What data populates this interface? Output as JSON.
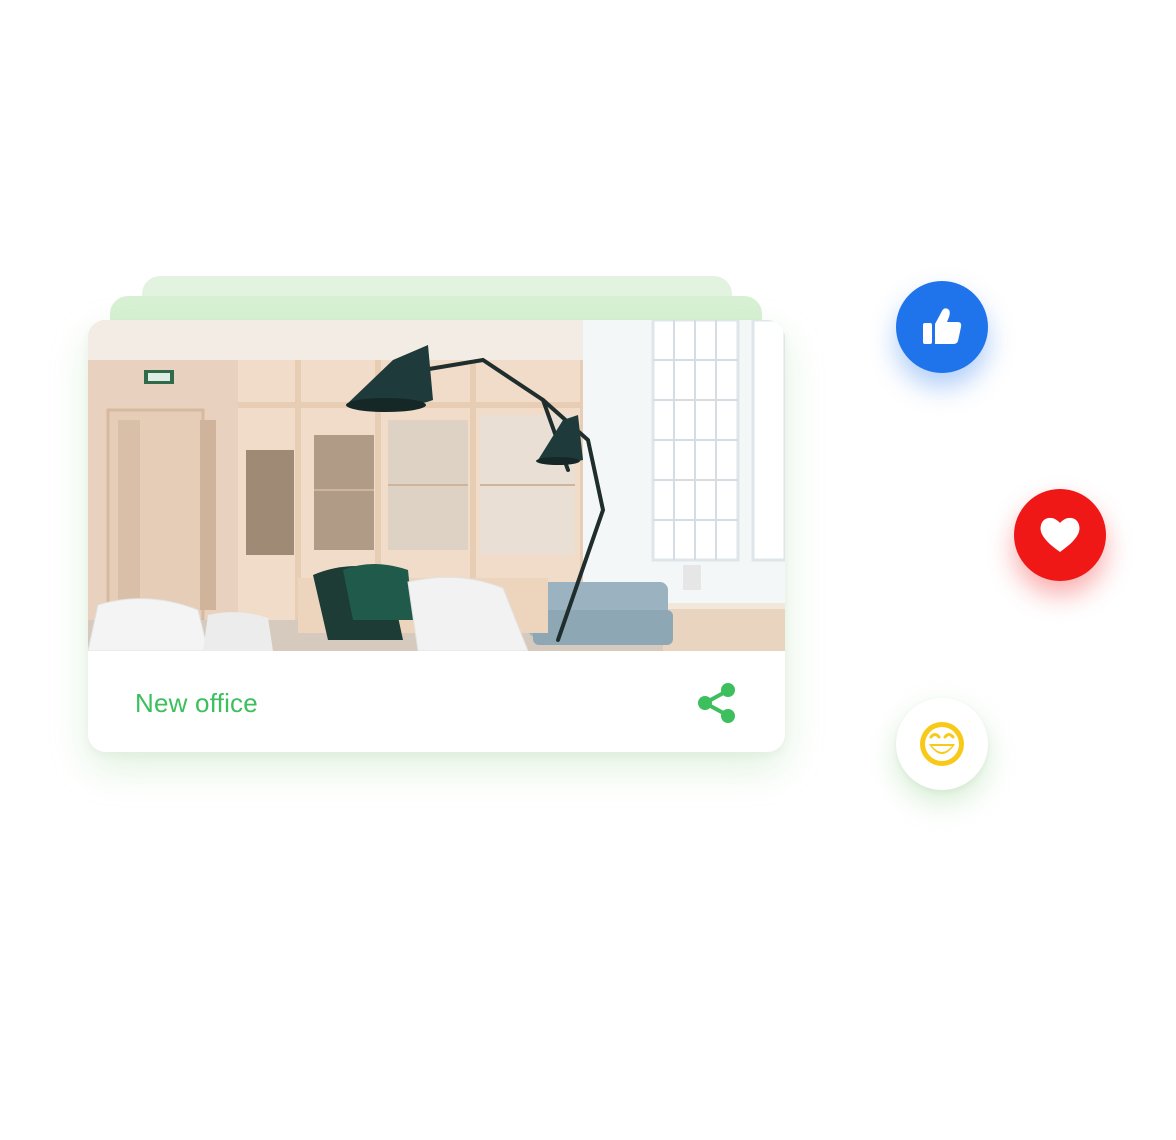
{
  "post_card": {
    "title": "New office",
    "photo_icon": "office-photo",
    "share_icon": "share-icon"
  },
  "reactions": [
    {
      "name": "like",
      "icon": "thumbs-up-icon",
      "color": "#1f74ec"
    },
    {
      "name": "love",
      "icon": "heart-icon",
      "color": "#f01717"
    },
    {
      "name": "haha",
      "icon": "grinning-face-icon",
      "color": "#f6c514"
    }
  ],
  "colors": {
    "accent": "#3cbf5c",
    "card_stack_back": "#d8f0d4"
  }
}
